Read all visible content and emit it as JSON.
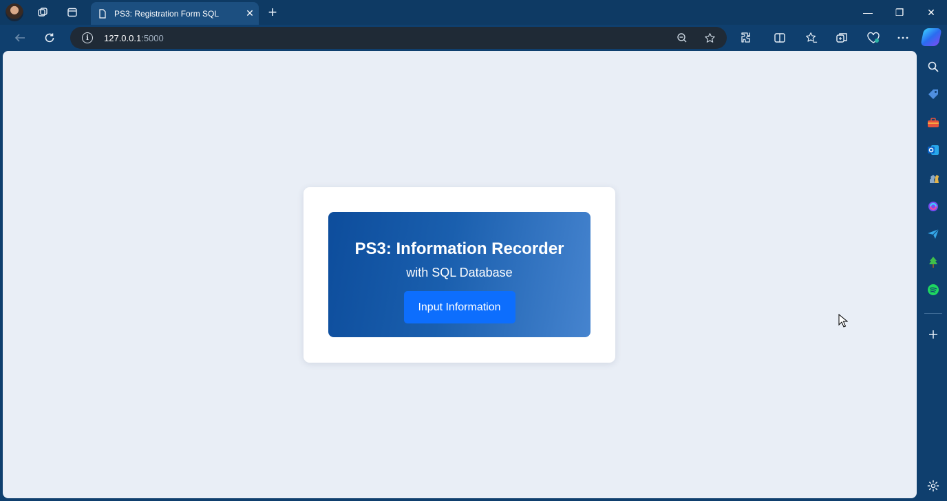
{
  "browser": {
    "tab_title": "PS3: Registration Form SQL",
    "tab_close": "✕",
    "new_tab": "+",
    "url_host": "127.0.0.1",
    "url_port": ":5000",
    "window_controls": {
      "minimize": "—",
      "restore": "❐",
      "close": "✕"
    }
  },
  "hero": {
    "title": "PS3: Information Recorder",
    "subtitle": "with SQL Database",
    "button_label": "Input Information",
    "gradient_start": "#0d4d9c",
    "gradient_end": "#4684cf",
    "button_color": "#0d6efd"
  },
  "sidebar": {
    "icons": [
      "search-icon",
      "tag-icon",
      "toolbox-icon",
      "outlook-icon",
      "chess-icon",
      "copilot-icon",
      "send-icon",
      "tree-icon",
      "spotify-icon",
      "add-icon",
      "settings-icon"
    ]
  }
}
